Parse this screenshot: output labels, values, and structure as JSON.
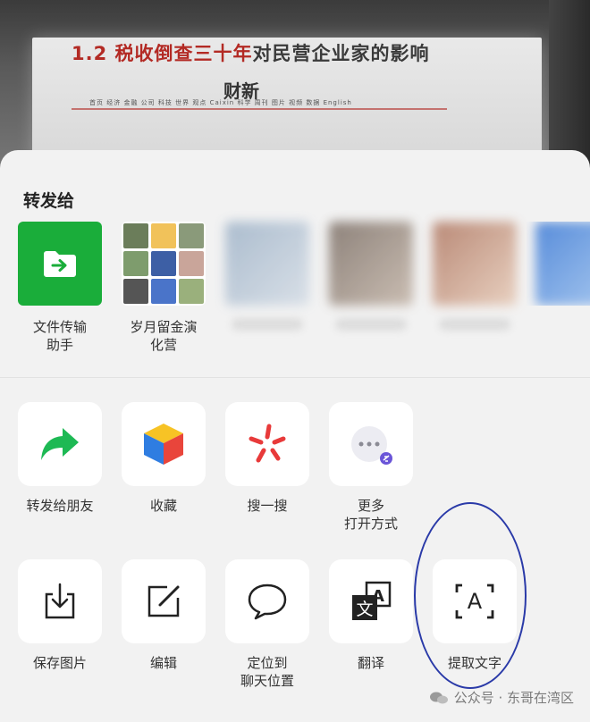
{
  "background": {
    "slide_title_red": "1.2 税收倒查三十年",
    "slide_title_dark": "对民营企业家的影响",
    "slide_brand": "财新",
    "slide_nav": "首页  经济  金融  公司  科技  世界  观点  Caixin  科学  周刊  图片  视频  数据  English"
  },
  "share": {
    "title": "转发给",
    "contacts": [
      {
        "label": "文件传输\n助手",
        "icon": "folder-forward-icon"
      },
      {
        "label": "岁月留金演\n化营",
        "icon": "group-avatar-icon"
      },
      {
        "label": "",
        "icon": "blurred-avatar"
      },
      {
        "label": "",
        "icon": "blurred-avatar"
      },
      {
        "label": "",
        "icon": "blurred-avatar"
      },
      {
        "label": "",
        "icon": "blurred-avatar"
      }
    ]
  },
  "actions_row1": [
    {
      "label": "转发给朋友",
      "icon": "forward-arrow-icon"
    },
    {
      "label": "收藏",
      "icon": "cube-icon"
    },
    {
      "label": "搜一搜",
      "icon": "search-star-icon"
    },
    {
      "label": "更多\n打开方式",
      "icon": "more-icon"
    }
  ],
  "actions_row2": [
    {
      "label": "保存图片",
      "icon": "download-icon"
    },
    {
      "label": "编辑",
      "icon": "edit-icon"
    },
    {
      "label": "定位到\n聊天位置",
      "icon": "chat-bubble-icon"
    },
    {
      "label": "翻译",
      "icon": "translate-icon"
    },
    {
      "label": "提取文字",
      "icon": "extract-text-icon"
    }
  ],
  "watermark": "公众号 · 东哥在湾区",
  "colors": {
    "file_green": "#1aad3a",
    "forward_green": "#1db954",
    "annotation_blue": "#2a3aa8"
  }
}
